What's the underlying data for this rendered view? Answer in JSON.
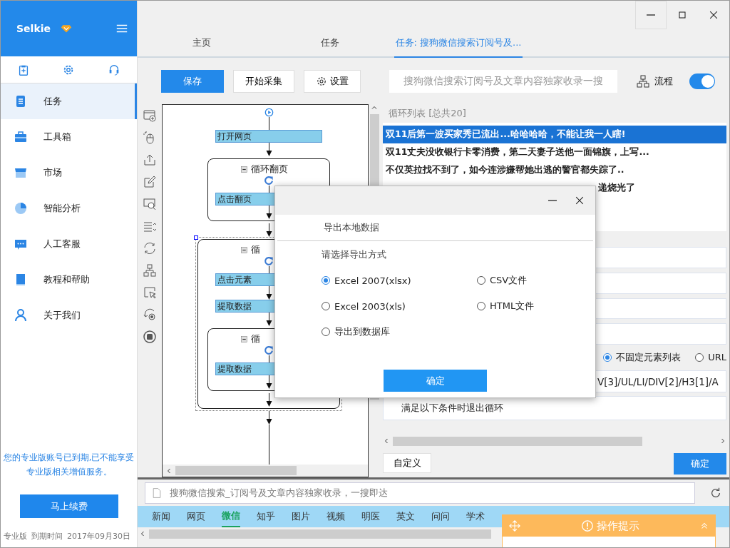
{
  "sidebar": {
    "app_name": "Selkie",
    "items": [
      {
        "label": "任务",
        "selected": true
      },
      {
        "label": "工具箱",
        "selected": false
      },
      {
        "label": "市场",
        "selected": false
      },
      {
        "label": "智能分析",
        "selected": false
      },
      {
        "label": "人工客服",
        "selected": false
      },
      {
        "label": "教程和帮助",
        "selected": false
      },
      {
        "label": "关于我们",
        "selected": false
      }
    ],
    "notice": "您的专业版账号已到期,已不能享受专业版相关增值服务。",
    "renew_button": "马上续费",
    "edition": "专业版",
    "expiry_label": "到期时间",
    "expiry_date": "2017年09月30日"
  },
  "tabs": [
    {
      "label": "主页",
      "selected": false
    },
    {
      "label": "任务",
      "selected": false
    },
    {
      "label": "任务: 搜狗微信搜索订阅号及...",
      "selected": true
    }
  ],
  "toolbar": {
    "save_button": "保存",
    "start_button": "开始采集",
    "settings_button": "设置",
    "task_name": "搜狗微信搜索订阅号及文章内容独家收录一搜",
    "flow_label": "流程",
    "flow_on": true
  },
  "flow": {
    "steps": [
      {
        "kind": "action",
        "label": "打开网页"
      },
      {
        "kind": "loop",
        "title": "循环翻页",
        "expanded": true,
        "selected": false,
        "children": [
          {
            "kind": "action",
            "label": "点击翻页"
          }
        ]
      },
      {
        "kind": "loop",
        "title": "循",
        "expanded": true,
        "selected": true,
        "children": [
          {
            "kind": "action",
            "label": "点击元素"
          },
          {
            "kind": "action",
            "label": "提取数据"
          },
          {
            "kind": "loop",
            "title": "循",
            "expanded": true,
            "selected": false,
            "children": [
              {
                "kind": "action",
                "label": "提取数据"
              }
            ]
          }
        ]
      }
    ]
  },
  "loop_panel": {
    "title": "循环列表 [总共20]",
    "rows": [
      {
        "text": "双11后第一波买家秀已流出...哈哈哈哈，不能让我一人瞎!",
        "selected": true,
        "covered": false
      },
      {
        "text": "双11丈夫没收银行卡零消费，第二天妻子送他一面锦旗，上写...",
        "selected": false,
        "covered": false
      },
      {
        "text": "不仅英拉找不到了，如今连涉嫌帮她出逃的警官都失踪了..",
        "selected": false,
        "covered": false
      },
      {
        "text": "递烧光了",
        "selected": false,
        "covered": true
      }
    ],
    "loop_types": [
      {
        "label": "不固定元素列表",
        "selected": true
      },
      {
        "label": "URL",
        "selected": false
      }
    ],
    "xpath": "V[3]/UL/LI/DIV[2]/H3[1]/A",
    "exit_condition": "满足以下条件时退出循环",
    "custom_button": "自定义",
    "ok_button": "确定"
  },
  "browser": {
    "address": "搜狗微信搜索_订阅号及文章内容独家收录，一搜即达",
    "nav": [
      {
        "label": "新闻",
        "selected": false
      },
      {
        "label": "网页",
        "selected": false
      },
      {
        "label": "微信",
        "selected": true
      },
      {
        "label": "知乎",
        "selected": false
      },
      {
        "label": "图片",
        "selected": false
      },
      {
        "label": "视频",
        "selected": false
      },
      {
        "label": "明医",
        "selected": false
      },
      {
        "label": "英文",
        "selected": false
      },
      {
        "label": "问问",
        "selected": false
      },
      {
        "label": "学术",
        "selected": false
      }
    ]
  },
  "hint_panel": {
    "title": "操作提示"
  },
  "dialog": {
    "heading": "导出本地数据",
    "prompt": "请选择导出方式",
    "options": [
      {
        "label": "Excel 2007(xlsx)",
        "selected": true
      },
      {
        "label": "CSV文件",
        "selected": false
      },
      {
        "label": "Excel 2003(xls)",
        "selected": false
      },
      {
        "label": "HTML文件",
        "selected": false
      },
      {
        "label": "导出到数据库",
        "selected": false
      }
    ],
    "ok_button": "确定"
  }
}
